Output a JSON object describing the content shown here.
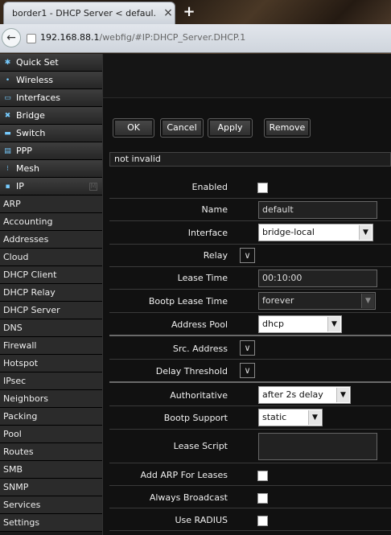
{
  "browser": {
    "tab_title": "border1 - DHCP Server < defaul...",
    "close_glyph": "×",
    "new_tab_glyph": "+",
    "back_glyph": "←",
    "url_host": "192.168.88.1",
    "url_path": "/webfig/#IP:DHCP_Server.DHCP.1"
  },
  "sidebar": {
    "top_items": [
      {
        "label": "Quick Set",
        "icon": "wand-icon"
      },
      {
        "label": "Wireless",
        "icon": "antenna-icon"
      },
      {
        "label": "Interfaces",
        "icon": "ethernet-icon"
      },
      {
        "label": "Bridge",
        "icon": "bridge-icon"
      },
      {
        "label": "Switch",
        "icon": "switch-icon"
      },
      {
        "label": "PPP",
        "icon": "ppp-icon"
      },
      {
        "label": "Mesh",
        "icon": "mesh-icon"
      },
      {
        "label": "IP",
        "icon": "ip-icon",
        "badge": "M"
      }
    ],
    "ip_sub_items": [
      "ARP",
      "Accounting",
      "Addresses",
      "Cloud",
      "DHCP Client",
      "DHCP Relay",
      "DHCP Server",
      "DNS",
      "Firewall",
      "Hotspot",
      "IPsec",
      "Neighbors",
      "Packing",
      "Pool",
      "Routes",
      "SMB",
      "SNMP",
      "Services",
      "Settings"
    ]
  },
  "buttons": {
    "ok": "OK",
    "cancel": "Cancel",
    "apply": "Apply",
    "remove": "Remove"
  },
  "status_text": "not invalid",
  "form": {
    "enabled_label": "Enabled",
    "name_label": "Name",
    "name_value": "default",
    "interface_label": "Interface",
    "interface_value": "bridge-local",
    "relay_label": "Relay",
    "lease_time_label": "Lease Time",
    "lease_time_value": "00:10:00",
    "bootp_lease_time_label": "Bootp Lease Time",
    "bootp_lease_time_value": "forever",
    "address_pool_label": "Address Pool",
    "address_pool_value": "dhcp",
    "src_address_label": "Src. Address",
    "delay_threshold_label": "Delay Threshold",
    "authoritative_label": "Authoritative",
    "authoritative_value": "after 2s delay",
    "bootp_support_label": "Bootp Support",
    "bootp_support_value": "static",
    "lease_script_label": "Lease Script",
    "add_arp_label": "Add ARP For Leases",
    "always_broadcast_label": "Always Broadcast",
    "use_radius_label": "Use RADIUS",
    "dropdown_glyph": "▼",
    "expand_glyph": "∨"
  }
}
